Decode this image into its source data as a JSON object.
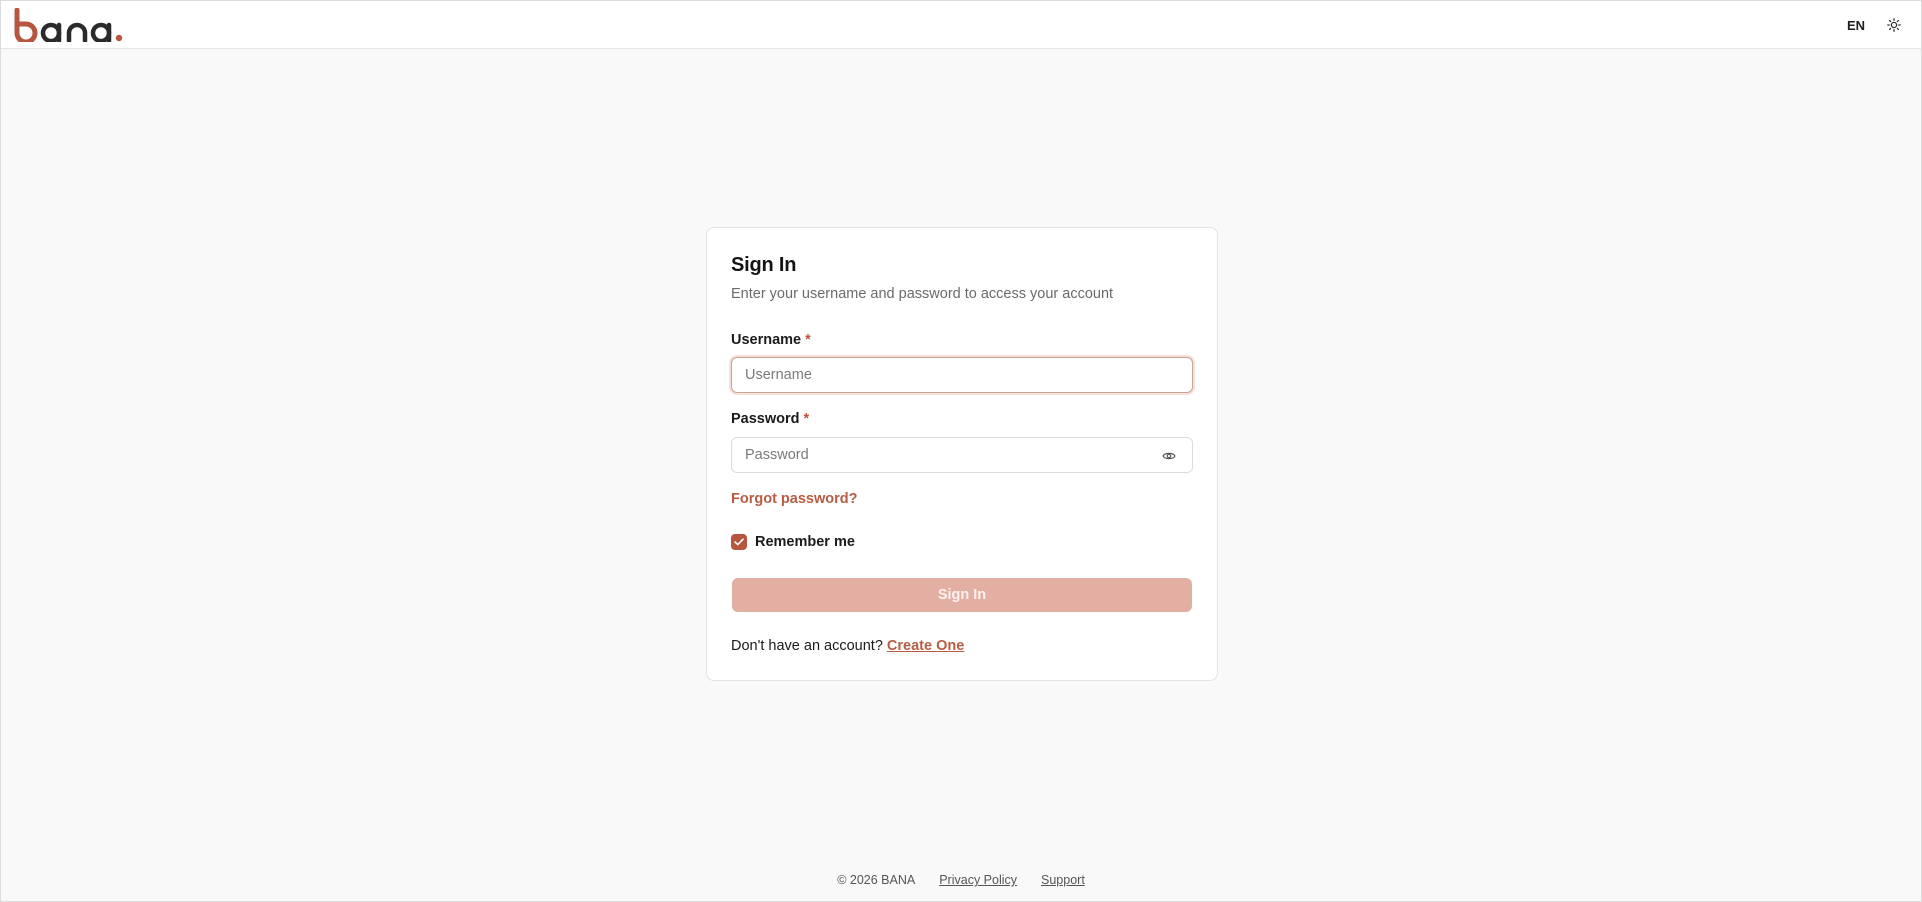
{
  "header": {
    "logo_text": "bana.",
    "language": "EN",
    "theme_icon": "sun-icon"
  },
  "login": {
    "title": "Sign In",
    "subtitle": "Enter your username and password to access your account",
    "username_label": "Username",
    "username_placeholder": "Username",
    "username_value": "",
    "password_label": "Password",
    "password_placeholder": "Password",
    "password_value": "",
    "required_marker": "*",
    "password_toggle_icon": "eye-icon",
    "forgot_password": "Forgot password?",
    "remember_me": "Remember me",
    "remember_checked": true,
    "submit_label": "Sign In",
    "signup_prompt": "Don't have an account?",
    "signup_link": "Create One"
  },
  "footer": {
    "copyright": "© 2026 BANA",
    "privacy": "Privacy Policy",
    "support": "Support"
  },
  "colors": {
    "brand": "#b8553f",
    "brand_muted": "#e3afa3",
    "background": "#f9f9f9"
  }
}
